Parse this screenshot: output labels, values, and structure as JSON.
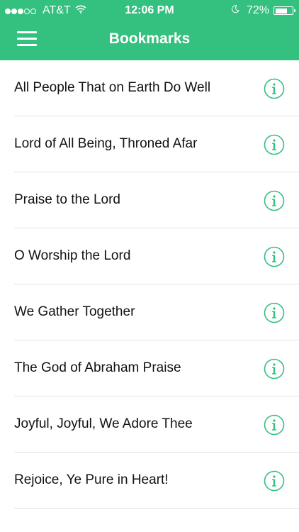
{
  "status_bar": {
    "carrier": "AT&T",
    "time": "12:06 PM",
    "battery": "72%",
    "battery_level": 0.72,
    "signal_bars_filled": 3,
    "signal_bars_total": 5,
    "icons": [
      "wifi-icon",
      "moon-icon",
      "battery-icon"
    ]
  },
  "header": {
    "title": "Bookmarks",
    "menu_icon": "hamburger-menu-icon",
    "background_color": "#34c07f"
  },
  "bookmarks": [
    {
      "title": "All People That on Earth Do Well",
      "icon": "info-icon"
    },
    {
      "title": "Lord of All Being, Throned Afar",
      "icon": "info-icon"
    },
    {
      "title": "Praise to the Lord",
      "icon": "info-icon"
    },
    {
      "title": "O Worship the Lord",
      "icon": "info-icon"
    },
    {
      "title": "We Gather Together",
      "icon": "info-icon"
    },
    {
      "title": "The God of Abraham Praise",
      "icon": "info-icon"
    },
    {
      "title": "Joyful, Joyful, We Adore Thee",
      "icon": "info-icon"
    },
    {
      "title": "Rejoice, Ye Pure in Heart!",
      "icon": "info-icon"
    }
  ],
  "accent_color": "#34c07f"
}
